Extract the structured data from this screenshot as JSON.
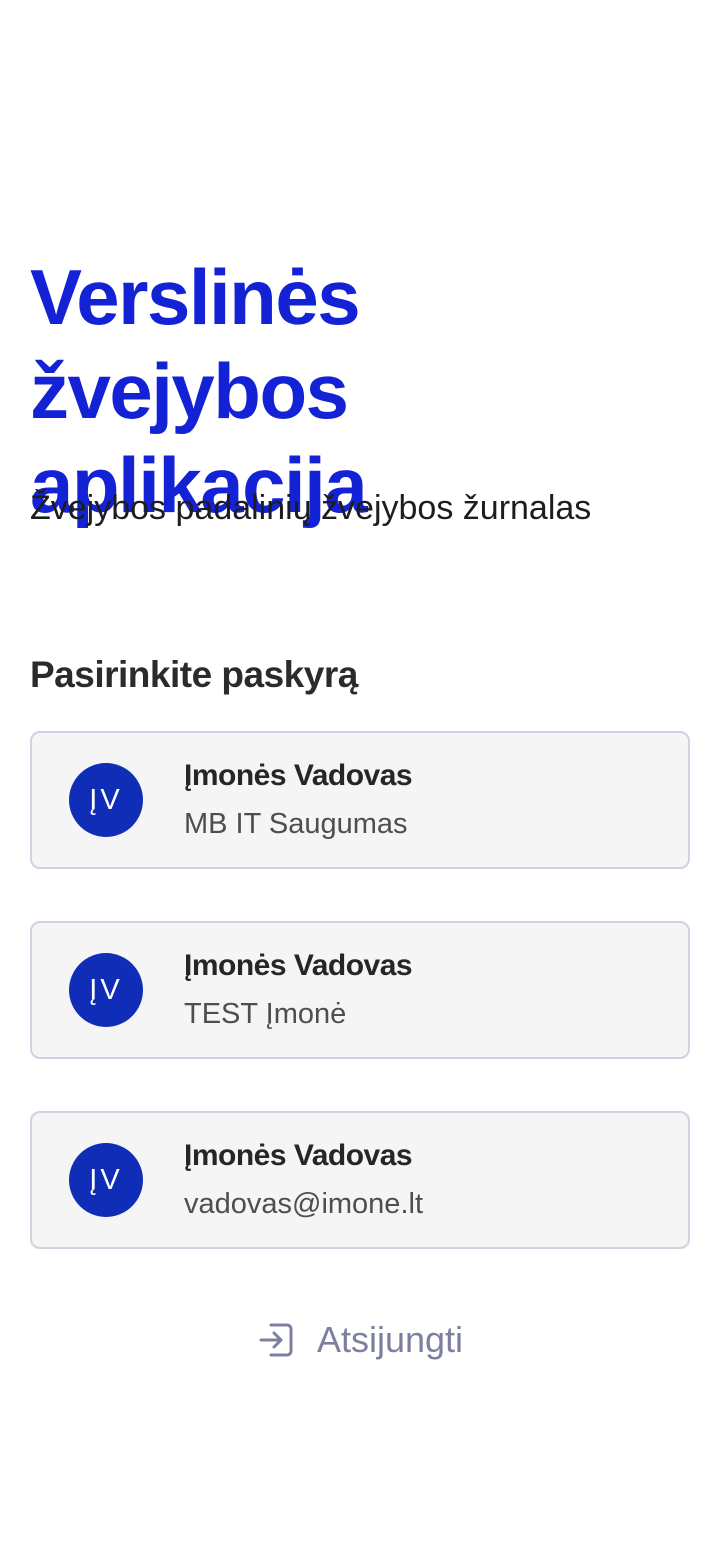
{
  "header": {
    "title": "Verslinės žvejybos aplikacija",
    "subtitle": "Žvejybos padalinių žvejybos žurnalas"
  },
  "accounts_section": {
    "title": "Pasirinkite paskyrą",
    "accounts": [
      {
        "initials": "ĮV",
        "name": "Įmonės Vadovas",
        "detail": "MB IT Saugumas"
      },
      {
        "initials": "ĮV",
        "name": "Įmonės Vadovas",
        "detail": "TEST Įmonė"
      },
      {
        "initials": "ĮV",
        "name": "Įmonės Vadovas",
        "detail": "vadovas@imone.lt"
      }
    ]
  },
  "logout": {
    "label": "Atsijungti",
    "icon": "logout-icon"
  },
  "colors": {
    "accent": "#1422d6",
    "avatar": "#102db8",
    "card_background": "#f5f5f6",
    "card_border": "#cfd2e0",
    "muted": "#7d7fa0"
  }
}
